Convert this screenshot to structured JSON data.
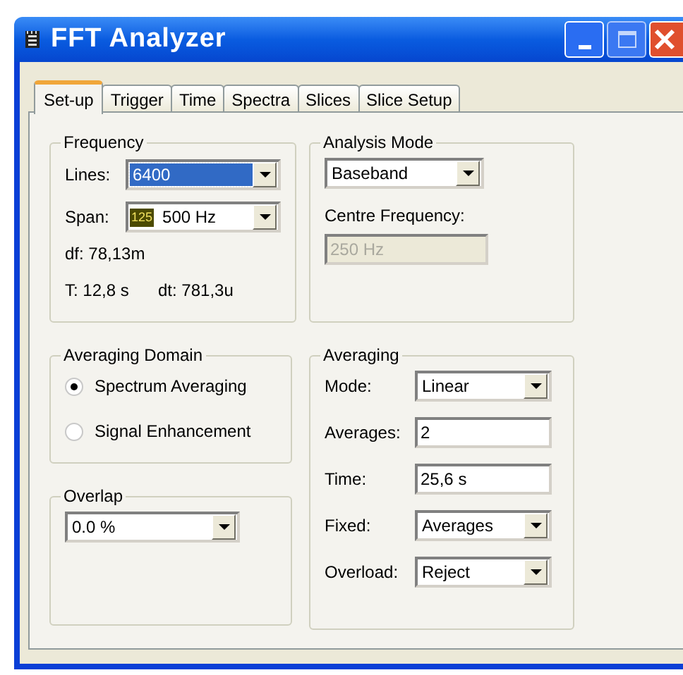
{
  "window": {
    "title": "FFT Analyzer"
  },
  "tabs": [
    {
      "label": "Set-up",
      "selected": true
    },
    {
      "label": "Trigger",
      "selected": false
    },
    {
      "label": "Time",
      "selected": false
    },
    {
      "label": "Spectra",
      "selected": false
    },
    {
      "label": "Slices",
      "selected": false
    },
    {
      "label": "Slice Setup",
      "selected": false
    }
  ],
  "frequency": {
    "title": "Frequency",
    "fields": [
      {
        "label": "Lines:",
        "kind": "dropdown",
        "value": "6400",
        "focused": true
      },
      {
        "label": "Span:",
        "kind": "dropdown",
        "value": "500 Hz",
        "badge": "125",
        "focused": false
      }
    ],
    "df": "df: 78,13m",
    "t": "T: 12,8 s",
    "dt": "dt: 781,3u"
  },
  "analysis_mode": {
    "title": "Analysis Mode",
    "value": "Baseband",
    "centre_label": "Centre Frequency:",
    "centre_value": "250 Hz",
    "centre_disabled": true
  },
  "averaging_domain": {
    "title": "Averaging Domain",
    "options": [
      {
        "label": "Spectrum Averaging",
        "selected": true
      },
      {
        "label": "Signal Enhancement",
        "selected": false
      }
    ]
  },
  "overlap": {
    "title": "Overlap",
    "value": "0.0 %"
  },
  "averaging": {
    "title": "Averaging",
    "fields": [
      {
        "label": "Mode:",
        "kind": "dropdown",
        "value": "Linear"
      },
      {
        "label": "Averages:",
        "kind": "text",
        "value": "2"
      },
      {
        "label": "Time:",
        "kind": "text",
        "value": "25,6 s"
      },
      {
        "label": "Fixed:",
        "kind": "dropdown",
        "value": "Averages"
      },
      {
        "label": "Overload:",
        "kind": "dropdown",
        "value": "Reject"
      }
    ]
  }
}
